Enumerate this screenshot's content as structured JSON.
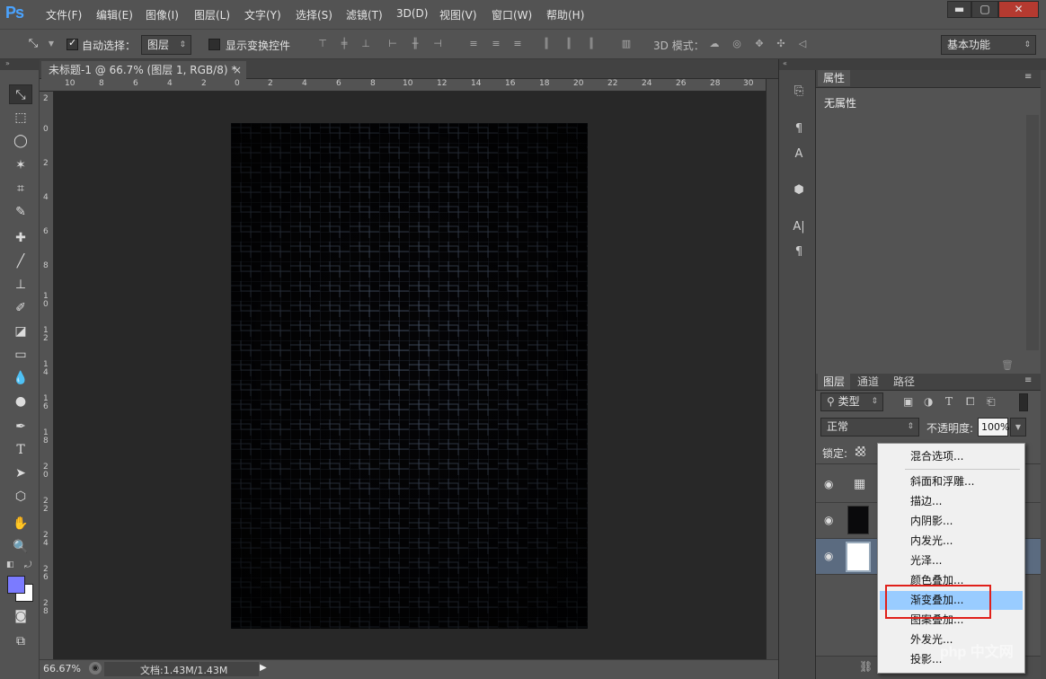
{
  "app": {
    "logo": "Ps"
  },
  "menubar": {
    "items": [
      "文件(F)",
      "编辑(E)",
      "图像(I)",
      "图层(L)",
      "文字(Y)",
      "选择(S)",
      "滤镜(T)",
      "3D(D)",
      "视图(V)",
      "窗口(W)",
      "帮助(H)"
    ],
    "window_controls": {
      "minimize": "▬",
      "maximize": "▢",
      "close": "✕"
    }
  },
  "options_bar": {
    "auto_select_label": "自动选择：",
    "auto_select_value": "图层",
    "show_transform_label": "显示变换控件",
    "mode3d_label": "3D 模式：",
    "workspace_value": "基本功能"
  },
  "document": {
    "tab_title": "未标题-1 @ 66.7% (图层 1, RGB/8) *",
    "tab_close": "×",
    "ruler_top": [
      "10",
      "8",
      "6",
      "4",
      "2",
      "0",
      "2",
      "4",
      "6",
      "8",
      "10",
      "12",
      "14",
      "16",
      "18",
      "20",
      "22",
      "24",
      "26",
      "28",
      "30"
    ],
    "ruler_left": [
      "2",
      "0",
      "2",
      "4",
      "6",
      "8",
      "1 0",
      "1 2",
      "1 4",
      "1 6",
      "1 8",
      "2 0",
      "2 2",
      "2 4",
      "2 6",
      "2 8"
    ],
    "zoom": "66.67%",
    "doc_size": "文档:1.43M/1.43M"
  },
  "properties_panel": {
    "title": "属性",
    "content": "无属性"
  },
  "layers_panel": {
    "tabs": [
      "图层",
      "通道",
      "路径"
    ],
    "filter_label": "类型",
    "blend_mode": "正常",
    "opacity_label": "不透明度:",
    "opacity_value": "100%",
    "lock_label": "锁定:"
  },
  "context_menu": {
    "items": [
      "混合选项...",
      "斜面和浮雕...",
      "描边...",
      "内阴影...",
      "内发光...",
      "光泽...",
      "颜色叠加...",
      "渐变叠加...",
      "图案叠加...",
      "外发光...",
      "投影..."
    ],
    "highlighted_index": 7
  },
  "watermark": "php 中文网",
  "colors": {
    "foreground": "#7b7bff",
    "background": "#ffffff",
    "highlight": "#99ccff",
    "annotation": "#e0201a"
  }
}
